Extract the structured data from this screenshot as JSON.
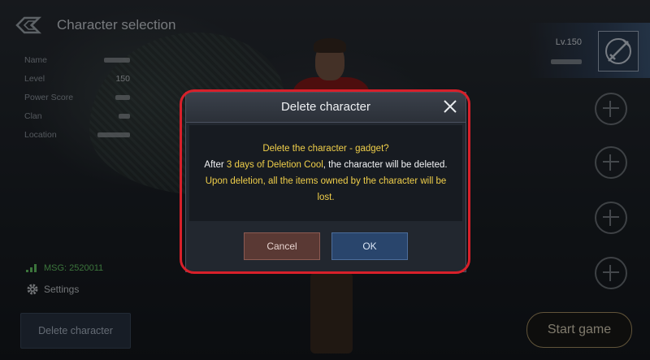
{
  "topbar": {
    "title": "Character selection",
    "back_icon": "back-arrow-icon"
  },
  "character_info": {
    "name_label": "Name",
    "level_label": "Level",
    "level_value": "150",
    "power_label": "Power Score",
    "clan_label": "Clan",
    "location_label": "Location"
  },
  "status": {
    "msg": "MSG: 2520011"
  },
  "settings": {
    "label": "Settings",
    "icon": "gear-icon"
  },
  "delete_button": {
    "label": "Delete character"
  },
  "slots": {
    "active": {
      "level": "Lv.150",
      "emblem_icon": "crossed-swords-icon"
    },
    "empty_icon": "plus-circle-icon"
  },
  "start_button": {
    "label": "Start game"
  },
  "modal": {
    "title": "Delete character",
    "line1": "Delete the character - gadget?",
    "line2_prefix": "After ",
    "line2_highlight": "3 days of Deletion Cool",
    "line2_suffix": ", the character will be deleted.",
    "line3": "Upon deletion, all the items owned by the character will be",
    "line4": "lost.",
    "cancel_label": "Cancel",
    "ok_label": "OK",
    "close_icon": "close-icon"
  },
  "colors": {
    "highlight_border": "#d8202a",
    "warning_text": "#f0cf4a",
    "msg_text": "#6cd46c",
    "cancel_bg": "#5a3934",
    "ok_bg": "#29456c"
  }
}
